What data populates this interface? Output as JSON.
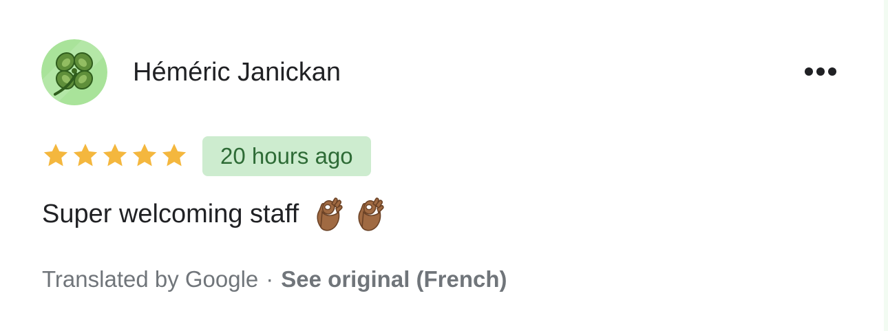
{
  "review": {
    "author": {
      "name": "Héméric Janickan",
      "avatar_icon": "four-leaf-clover-icon"
    },
    "menu_icon": "more-horizontal-icon",
    "rating": {
      "stars_filled": 5,
      "stars_total": 5,
      "star_color": "#F4B73E"
    },
    "time_ago": "20 hours ago",
    "text": "Super welcoming staff",
    "emojis": [
      "ok-hand-medium-dark-skin-emoji",
      "ok-hand-medium-dark-skin-emoji"
    ],
    "translation": {
      "label": "Translated by Google",
      "separator": "·",
      "see_original": "See original (French)"
    }
  },
  "colors": {
    "badge_bg": "#CDECCF",
    "badge_text": "#2E6B36",
    "muted_text": "#70757A"
  }
}
